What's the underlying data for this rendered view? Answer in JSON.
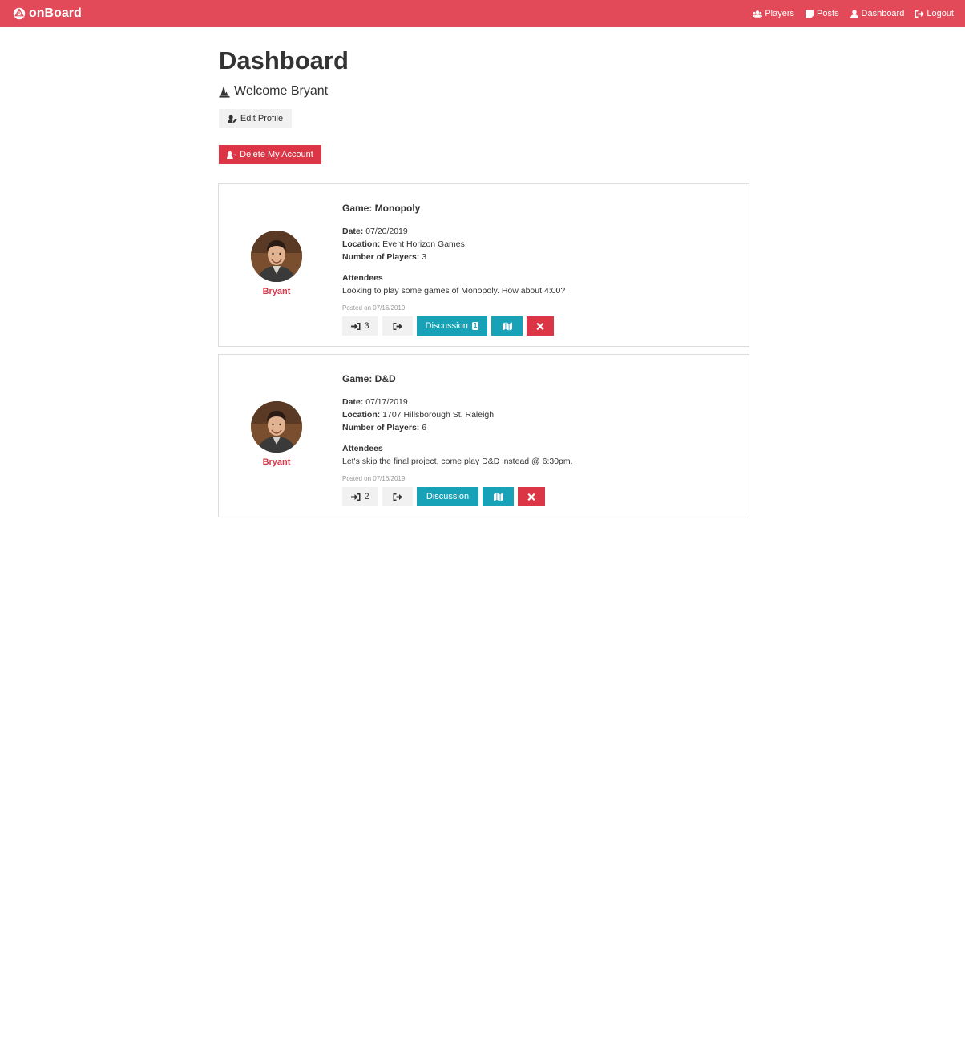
{
  "navbar": {
    "brand": "onBoard",
    "links": [
      {
        "label": "Players",
        "icon": "users-icon"
      },
      {
        "label": "Posts",
        "icon": "sticky-note-icon"
      },
      {
        "label": "Dashboard",
        "icon": "user-icon"
      },
      {
        "label": "Logout",
        "icon": "sign-out-icon"
      }
    ]
  },
  "page": {
    "title": "Dashboard",
    "welcome": "Welcome Bryant",
    "edit_profile_label": "Edit Profile",
    "delete_account_label": "Delete My Account"
  },
  "labels": {
    "date": "Date:",
    "location": "Location:",
    "players": "Number of Players:",
    "attendees": "Attendees"
  },
  "posts": [
    {
      "author": "Bryant",
      "game": "Game: Monopoly",
      "date": "07/20/2019",
      "location": "Event Horizon Games",
      "players": "3",
      "description": "Looking to play some games of Monopoly. How about 4:00?",
      "posted_on": "Posted on 07/16/2019",
      "join_count": "3",
      "discussion_label": "Discussion",
      "discussion_badge": "1"
    },
    {
      "author": "Bryant",
      "game": "Game: D&D",
      "date": "07/17/2019",
      "location": "1707 Hillsborough St. Raleigh",
      "players": "6",
      "description": "Let's skip the final project, come play D&D instead @ 6:30pm.",
      "posted_on": "Posted on 07/16/2019",
      "join_count": "2",
      "discussion_label": "Discussion",
      "discussion_badge": ""
    }
  ],
  "colors": {
    "navbar": "#e24a59",
    "danger": "#dc3545",
    "info": "#17a2b8",
    "author_name": "#d63a49"
  }
}
